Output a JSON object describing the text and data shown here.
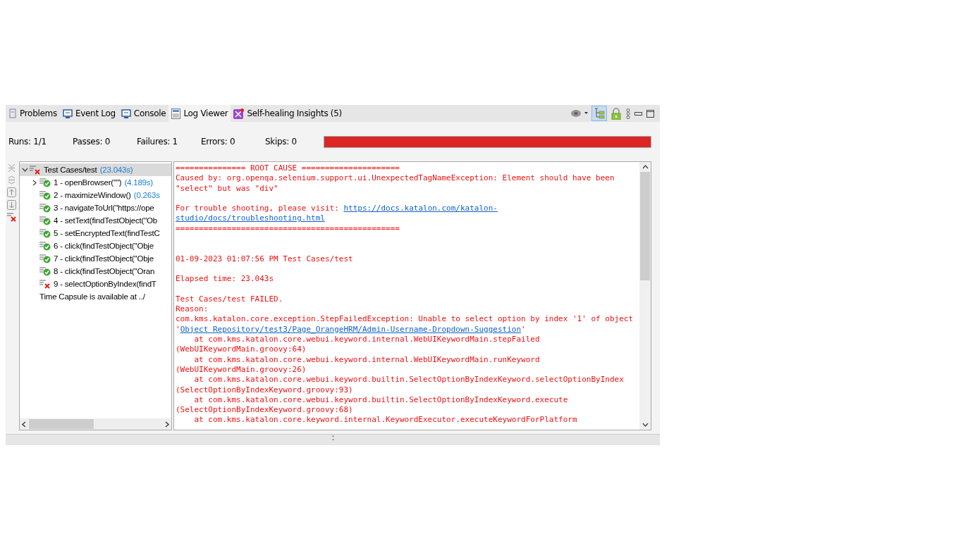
{
  "tabs": [
    {
      "label": "Problems",
      "selected": false
    },
    {
      "label": "Event Log",
      "selected": false
    },
    {
      "label": "Console",
      "selected": false
    },
    {
      "label": "Log Viewer",
      "selected": true
    },
    {
      "label": "Self-healing Insights (5)",
      "selected": false
    }
  ],
  "stats": [
    {
      "label": "Runs:",
      "value": "1/1"
    },
    {
      "label": "Passes:",
      "value": "0"
    },
    {
      "label": "Failures:",
      "value": "1"
    },
    {
      "label": "Errors:",
      "value": "0"
    },
    {
      "label": "Skips:",
      "value": "0"
    }
  ],
  "progress": {
    "level": 1,
    "failed": true
  },
  "tree": {
    "label": "Test Cases/test",
    "time": "(23.043s)",
    "kind": "fail",
    "expanded": true,
    "selected": true,
    "children": [
      {
        "label": "1 - openBrowser(\"\")",
        "time": "(4.189s)",
        "kind": "pass",
        "expandable": true
      },
      {
        "label": "2 - maximizeWindow()",
        "time": "(0.263s",
        "kind": "pass",
        "expandable": false
      },
      {
        "label": "3 - navigateToUrl(\"https://ope",
        "kind": "pass",
        "expandable": false
      },
      {
        "label": "4 - setText(findTestObject(\"Ob",
        "kind": "pass",
        "expandable": false
      },
      {
        "label": "5 - setEncryptedText(findTestC",
        "kind": "pass",
        "expandable": false
      },
      {
        "label": "6 - click(findTestObject(\"Obje",
        "kind": "pass",
        "expandable": false
      },
      {
        "label": "7 - click(findTestObject(\"Obje",
        "kind": "pass",
        "expandable": false
      },
      {
        "label": "8 - click(findTestObject(\"Oran",
        "kind": "pass",
        "expandable": false
      },
      {
        "label": "9 - selectOptionByIndex(findT",
        "kind": "fail",
        "expandable": false
      },
      {
        "label": "Time Capsule is available at ../",
        "kind": "note",
        "expandable": false
      }
    ]
  },
  "log": [
    {
      "kind": "text",
      "segments": [
        {
          "kind": "plain",
          "text": "=============== ROOT CAUSE ====================="
        }
      ]
    },
    {
      "kind": "text",
      "segments": [
        {
          "kind": "plain",
          "text": "Caused by: org.openqa.selenium.support.ui.UnexpectedTagNameException: Element should have been"
        }
      ]
    },
    {
      "kind": "text",
      "segments": [
        {
          "kind": "plain",
          "text": "\"select\" but was \"div\""
        }
      ]
    },
    {
      "kind": "blank"
    },
    {
      "kind": "text",
      "segments": [
        {
          "kind": "plain",
          "text": "For trouble shooting, please visit: "
        },
        {
          "kind": "link",
          "text": "https://docs.katalon.com/katalon-"
        }
      ]
    },
    {
      "kind": "text",
      "segments": [
        {
          "kind": "link",
          "text": "studio/docs/troubleshooting.html"
        }
      ]
    },
    {
      "kind": "text",
      "segments": [
        {
          "kind": "plain",
          "text": "================================================"
        }
      ]
    },
    {
      "kind": "blank"
    },
    {
      "kind": "blank"
    },
    {
      "kind": "text",
      "segments": [
        {
          "kind": "plain",
          "text": "01-09-2023 01:07:56 PM Test Cases/test"
        }
      ]
    },
    {
      "kind": "blank"
    },
    {
      "kind": "text",
      "segments": [
        {
          "kind": "plain",
          "text": "Elapsed time: 23.043s"
        }
      ]
    },
    {
      "kind": "blank"
    },
    {
      "kind": "text",
      "segments": [
        {
          "kind": "plain",
          "text": "Test Cases/test FAILED."
        }
      ]
    },
    {
      "kind": "text",
      "segments": [
        {
          "kind": "plain",
          "text": "Reason:"
        }
      ]
    },
    {
      "kind": "text",
      "segments": [
        {
          "kind": "plain",
          "text": "com.kms.katalon.core.exception.StepFailedException: Unable to select option by index '1' of object"
        }
      ]
    },
    {
      "kind": "text",
      "segments": [
        {
          "kind": "plain",
          "text": "'"
        },
        {
          "kind": "link",
          "text": "Object Repository/test3/Page_OrangeHRM/Admin-Username-Dropdown-Suggestion"
        },
        {
          "kind": "plain",
          "text": "'"
        }
      ]
    },
    {
      "kind": "text",
      "segments": [
        {
          "kind": "plain",
          "text": "    at com.kms.katalon.core.webui.keyword.internal.WebUIKeywordMain.stepFailed"
        }
      ]
    },
    {
      "kind": "text",
      "segments": [
        {
          "kind": "plain",
          "text": "(WebUIKeywordMain.groovy:64)"
        }
      ]
    },
    {
      "kind": "text",
      "segments": [
        {
          "kind": "plain",
          "text": "    at com.kms.katalon.core.webui.keyword.internal.WebUIKeywordMain.runKeyword"
        }
      ]
    },
    {
      "kind": "text",
      "segments": [
        {
          "kind": "plain",
          "text": "(WebUIKeywordMain.groovy:26)"
        }
      ]
    },
    {
      "kind": "text",
      "segments": [
        {
          "kind": "plain",
          "text": "    at com.kms.katalon.core.webui.keyword.builtin.SelectOptionByIndexKeyword.selectOptionByIndex"
        }
      ]
    },
    {
      "kind": "text",
      "segments": [
        {
          "kind": "plain",
          "text": "(SelectOptionByIndexKeyword.groovy:93)"
        }
      ]
    },
    {
      "kind": "text",
      "segments": [
        {
          "kind": "plain",
          "text": "    at com.kms.katalon.core.webui.keyword.builtin.SelectOptionByIndexKeyword.execute"
        }
      ]
    },
    {
      "kind": "text",
      "segments": [
        {
          "kind": "plain",
          "text": "(SelectOptionByIndexKeyword.groovy:68)"
        }
      ]
    },
    {
      "kind": "text",
      "segments": [
        {
          "kind": "plain",
          "text": "    at com.kms.katalon.core.keyword.internal.KeywordExecutor.executeKeywordForPlatform"
        }
      ]
    }
  ]
}
